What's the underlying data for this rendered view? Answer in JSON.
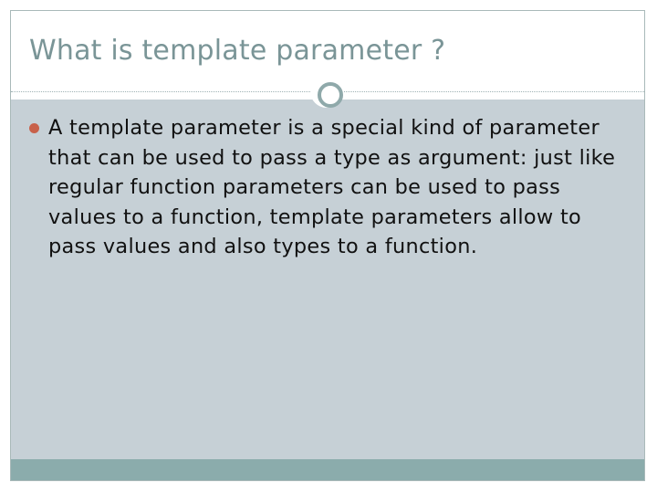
{
  "slide": {
    "title": "What is template parameter ?",
    "bullets": [
      {
        "text": "A template parameter is a special kind of parameter that can be used to pass a type as argument: just like regular function parameters can be used to pass values to a function, template parameters allow to pass values and also types to a function."
      }
    ]
  },
  "colors": {
    "title_text": "#7a9597",
    "content_background": "#c6d0d6",
    "bottom_bar": "#8bacac",
    "bullet_marker": "#c8614a",
    "ornament_ring": "#8fa9aa"
  },
  "icons": {
    "bullet": "filled-circle-bullet-icon",
    "ornament": "ring-ornament-icon"
  }
}
